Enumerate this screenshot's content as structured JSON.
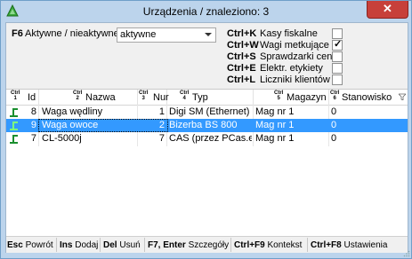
{
  "window": {
    "title": "Urządzenia / znaleziono: 3",
    "close_label": "✕"
  },
  "filters": {
    "f6_key": "F6",
    "active_label": "Aktywne / nieaktywne:",
    "active_value": "aktywne",
    "device_types": [
      {
        "key": "Ctrl+K",
        "label": "Kasy fiskalne",
        "checked": false
      },
      {
        "key": "Ctrl+W",
        "label": "Wagi metkujące",
        "checked": true
      },
      {
        "key": "Ctrl+S",
        "label": "Sprawdzarki cen",
        "checked": false
      },
      {
        "key": "Ctrl+E",
        "label": "Elektr. etykiety",
        "checked": false
      },
      {
        "key": "Ctrl+L",
        "label": "Liczniki klientów",
        "checked": false
      }
    ]
  },
  "table": {
    "ctrl_label": "Ctrl",
    "columns": [
      {
        "num": "1",
        "label": "Id"
      },
      {
        "num": "2",
        "label": "Nazwa"
      },
      {
        "num": "3",
        "label": "Nur"
      },
      {
        "num": "4",
        "label": "Typ"
      },
      {
        "num": "5",
        "label": "Magazyn"
      },
      {
        "num": "6",
        "label": "Stanowisko"
      }
    ],
    "rows": [
      {
        "id": "8",
        "name": "Waga wędliny",
        "nr": "1",
        "type": "Digi SM (Ethernet)",
        "warehouse": "Mag nr 1",
        "station": "0",
        "selected": false
      },
      {
        "id": "9",
        "name": "Waga owoce",
        "nr": "2",
        "type": "Bizerba BS 800",
        "warehouse": "Mag nr 1",
        "station": "0",
        "selected": true
      },
      {
        "id": "7",
        "name": "CL-5000j",
        "nr": "7",
        "type": "CAS (przez PCas.exe",
        "warehouse": "Mag nr 1",
        "station": "0",
        "selected": false
      }
    ]
  },
  "footer": [
    {
      "key": "Esc",
      "label": "Powrót"
    },
    {
      "key": "Ins",
      "label": "Dodaj"
    },
    {
      "key": "Del",
      "label": "Usuń"
    },
    {
      "key": "F7, Enter",
      "label": "Szczegóły"
    },
    {
      "key": "Ctrl+F9",
      "label": "Kontekst"
    },
    {
      "key": "Ctrl+F8",
      "label": "Ustawienia"
    }
  ],
  "colors": {
    "title_bg": "#bcd4ec",
    "selection": "#3399ff",
    "close_button": "#c7403a",
    "row_icon": "#1a8f2e"
  },
  "icons": {
    "app": "green-triangle-icon",
    "row": "scale-device-icon",
    "sort": "filter-sort-icon"
  }
}
